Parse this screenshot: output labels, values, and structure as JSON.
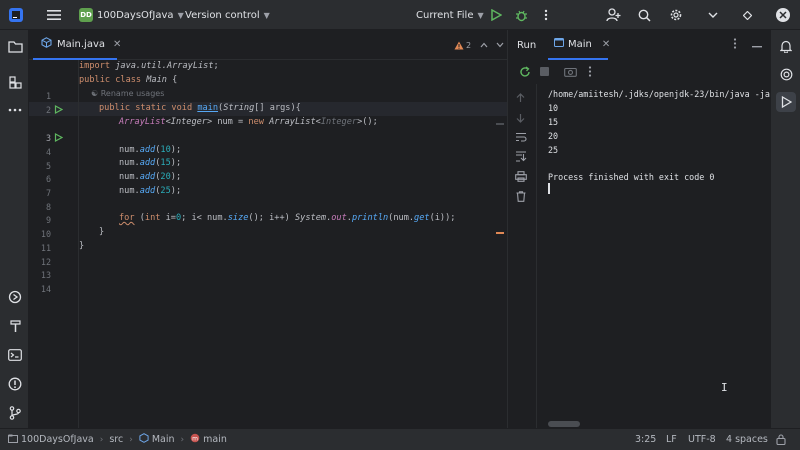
{
  "titlebar": {
    "project_badge": "DD",
    "project_name": "100DaysOfJava",
    "vcs": "Version control",
    "run_config": "Current File",
    "icons": [
      "app-logo-icon",
      "hamburger-menu-icon",
      "run-icon",
      "debug-icon",
      "more-icon",
      "add-user-icon",
      "search-icon",
      "settings-icon",
      "chevron-down-icon",
      "diamond-icon",
      "minimize-icon",
      "maximize-icon",
      "close-icon"
    ]
  },
  "editor": {
    "tab_label": "Main.java",
    "inspection_count": "2",
    "rename_hint": "Rename usages",
    "line_numbers": [
      "1",
      "2",
      "3",
      "4",
      "5",
      "6",
      "7",
      "8",
      "9",
      "10",
      "11",
      "12",
      "13",
      "14"
    ],
    "code": {
      "l1_kw": "import ",
      "l1_pkg": "java.util.ArrayList",
      "l1_end": ";",
      "l2_kw": "public class ",
      "l2_name": "Main",
      "l2_end": " {",
      "l3_kw": "public static void ",
      "l3_fn": "main",
      "l3_open": "(",
      "l3_type": "String",
      "l3_args": "[] args",
      "l3_end": "){",
      "l4_type1": "ArrayList",
      "l4_lt": "<",
      "l4_gen1": "Integer",
      "l4_mid": "> num = ",
      "l4_new": "new ",
      "l4_type2": "ArrayList",
      "l4_lt2": "<",
      "l4_gen2": "Integer",
      "l4_end": ">();",
      "add_prefix": "num.",
      "add_method": "add",
      "add_values": [
        "10",
        "15",
        "20",
        "25"
      ],
      "add_suffix": ");",
      "l11_for": "for",
      "l11_a": " (",
      "l11_int": "int",
      "l11_b": " i=",
      "l11_zero": "0",
      "l11_c": "; i< num.",
      "l11_size": "size",
      "l11_d": "(); i++) ",
      "l11_sys": "System",
      "l11_dot": ".",
      "l11_out": "out",
      "l11_dot2": ".",
      "l11_println": "println",
      "l11_e": "(num.",
      "l11_get": "get",
      "l11_f": "(i));",
      "close_brace": "}"
    }
  },
  "run": {
    "header_label": "Run",
    "tab_label": "Main",
    "command": "/home/amiitesh/.jdks/openjdk-23/bin/java -jav",
    "output": [
      "10",
      "15",
      "20",
      "25"
    ],
    "finish": "Process finished with exit code 0"
  },
  "statusbar": {
    "breadcrumb": [
      "100DaysOfJava",
      "src",
      "Main",
      "main"
    ],
    "position": "3:25",
    "line_sep": "LF",
    "encoding": "UTF-8",
    "indent": "4 spaces"
  }
}
